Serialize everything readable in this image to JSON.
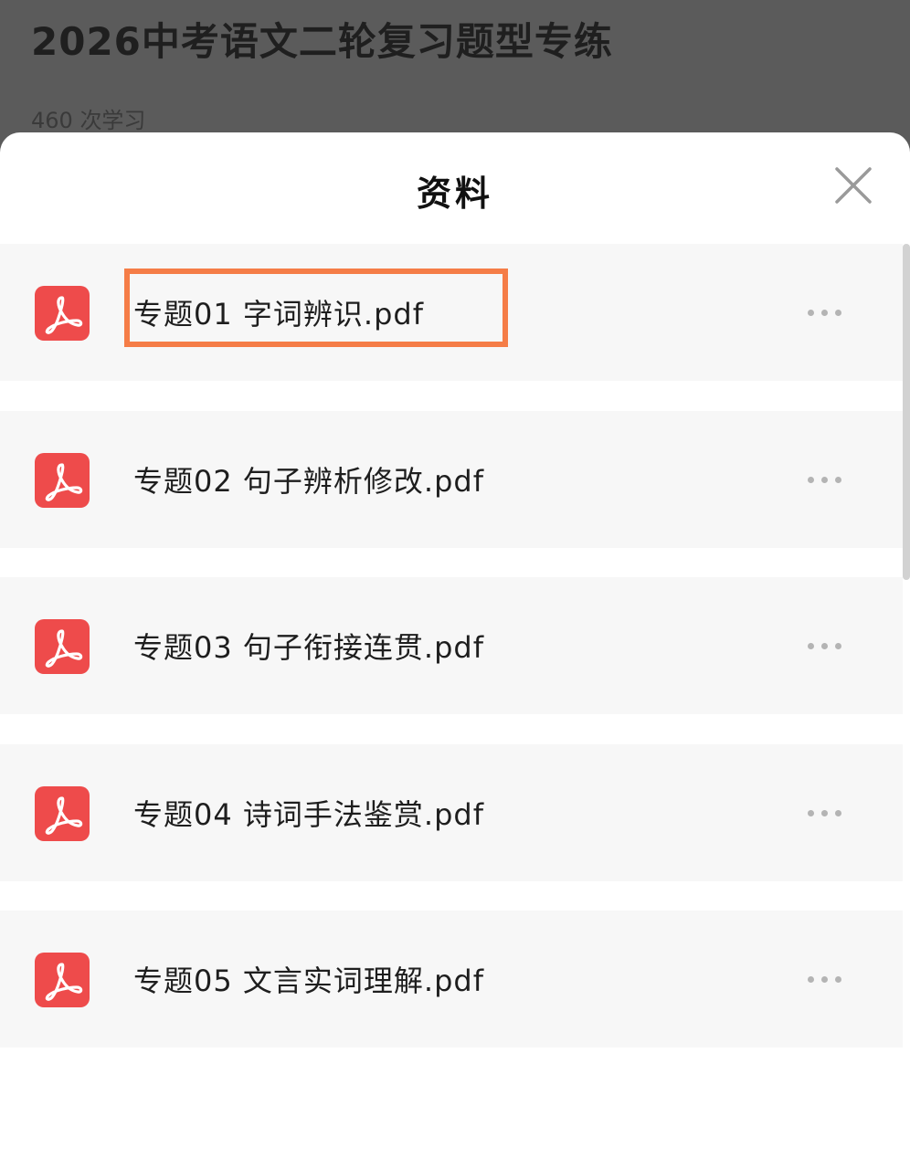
{
  "background_page": {
    "title": "2026中考语文二轮复习题型专练",
    "study_count": "460 次学习"
  },
  "sheet": {
    "title": "资料",
    "close_icon": "close-icon",
    "files": [
      {
        "name": "专题01 字词辨识.pdf",
        "icon": "pdf-icon",
        "highlighted": true
      },
      {
        "name": "专题02 句子辨析修改.pdf",
        "icon": "pdf-icon",
        "highlighted": false
      },
      {
        "name": "专题03 句子衔接连贯.pdf",
        "icon": "pdf-icon",
        "highlighted": false
      },
      {
        "name": "专题04 诗词手法鉴赏.pdf",
        "icon": "pdf-icon",
        "highlighted": false
      },
      {
        "name": "专题05 文言实词理解.pdf",
        "icon": "pdf-icon",
        "highlighted": false
      }
    ]
  },
  "colors": {
    "pdf_icon_bg": "#ee4b4b",
    "highlight_border": "#f57d47",
    "row_bg": "#f7f7f7",
    "backdrop": "#5b5b5b"
  }
}
